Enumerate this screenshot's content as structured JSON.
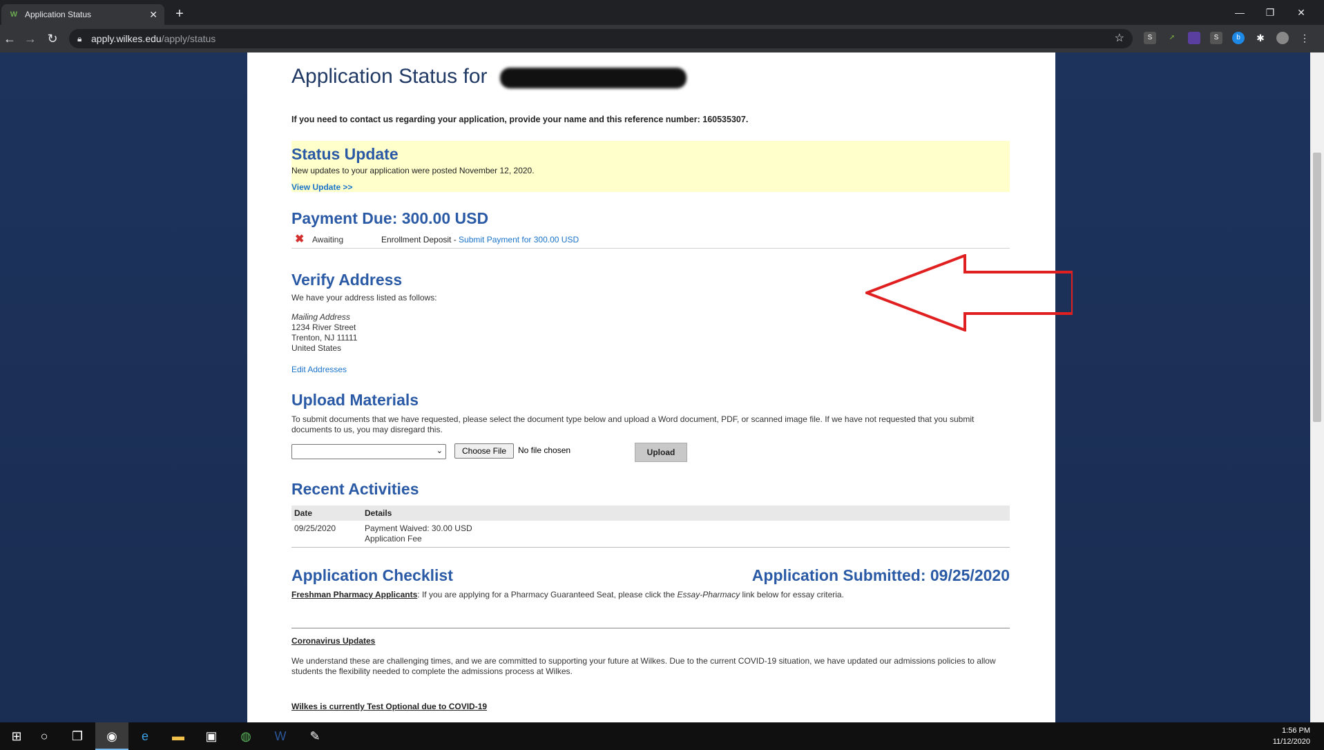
{
  "browser": {
    "tab_title": "Application Status",
    "tab_favicon": "W",
    "url_host": "apply.wilkes.edu",
    "url_path": "/apply/status",
    "icons": [
      "back-icon",
      "forward-icon",
      "reload-icon",
      "lock-icon",
      "star-icon",
      "extensions-icon",
      "menu-icon"
    ]
  },
  "page": {
    "title": "Application Status for",
    "reference_line": "If you need to contact us regarding your application, provide your name and this reference number: 160535307.",
    "status_update": {
      "heading": "Status Update",
      "posted": "New updates to your application were posted November 12, 2020.",
      "view_link": "View Update >>"
    },
    "payment": {
      "heading": "Payment Due: 300.00 USD",
      "status": "Awaiting",
      "item": "Enrollment Deposit - ",
      "link": "Submit Payment for 300.00 USD"
    },
    "verify": {
      "heading": "Verify Address",
      "intro": "We have your address listed as follows:",
      "label": "Mailing Address",
      "line1": "1234 River Street",
      "line2": "Trenton, NJ 11111",
      "line3": "United States",
      "edit_link": "Edit Addresses"
    },
    "upload": {
      "heading": "Upload Materials",
      "text": "To submit documents that we have requested, please select the document type below and upload a Word document, PDF, or scanned image file. If we have not requested that you submit documents to us, you may disregard this.",
      "select_value": "",
      "choose_file": "Choose File",
      "no_file": "No file chosen",
      "upload_button": "Upload"
    },
    "recent": {
      "heading": "Recent Activities",
      "columns": [
        "Date",
        "Details"
      ],
      "rows": [
        {
          "date": "09/25/2020",
          "detail": "Payment Waived: 30.00 USD",
          "sub": "Application Fee"
        }
      ]
    },
    "checklist": {
      "heading": "Application Checklist",
      "submitted": "Application Submitted: 09/25/2020",
      "fresh_label": "Freshman Pharmacy Applicants",
      "fresh_text_a": ": If you are applying for a Pharmacy Guaranteed Seat, please click the ",
      "fresh_italic": "Essay-Pharmacy",
      "fresh_text_b": " link below for essay criteria."
    },
    "corona": {
      "heading": "Coronavirus Updates",
      "text": "We understand these are challenging times, and we are committed to supporting your future at Wilkes. Due to the current COVID-19 situation, we have updated our admissions policies to allow students the flexibility needed to complete the admissions process at Wilkes.",
      "test_optional": "Wilkes is currently Test Optional due to COVID-19"
    }
  },
  "taskbar": {
    "time": "1:56 PM",
    "date": "11/12/2020"
  },
  "colors": {
    "heading": "#2a5aa5",
    "status_box": "#ffffcc",
    "link": "#1a73c9",
    "annotation_arrow": "#e02020"
  }
}
